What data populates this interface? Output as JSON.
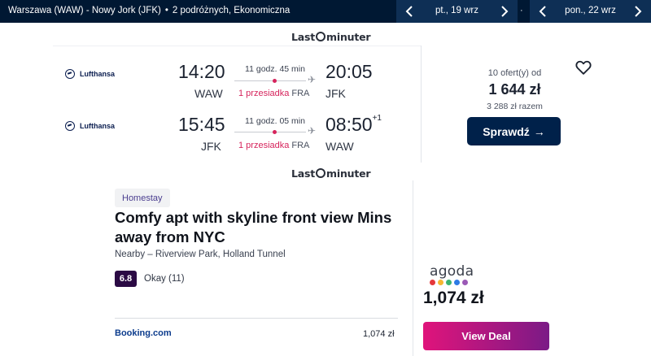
{
  "topbar": {
    "route": "Warszawa (WAW) - Nowy Jork (JFK)",
    "separator": "•",
    "passengers": "2 podróżnych, Ekonomiczna",
    "depart_date": "pt., 19 wrz",
    "return_date": "pon., 22 wrz",
    "mid_separator": "·"
  },
  "provider_logo_1": {
    "before": "Last",
    "after": "minuter"
  },
  "provider_logo_2": {
    "before": "Last",
    "after": "minuter"
  },
  "flight": {
    "outbound": {
      "airline": "Lufthansa",
      "depart_time": "14:20",
      "depart_airport": "WAW",
      "duration": "11 godz. 45 min",
      "stops": "1 przesiadka",
      "via": "FRA",
      "arrive_time": "20:05",
      "arrive_airport": "JFK",
      "day_offset": ""
    },
    "return": {
      "airline": "Lufthansa",
      "depart_time": "15:45",
      "depart_airport": "JFK",
      "duration": "11 godz. 05 min",
      "stops": "1 przesiadka",
      "via": "FRA",
      "arrive_time": "08:50",
      "arrive_airport": "WAW",
      "day_offset": "+1"
    },
    "offers_text": "10 ofert(y) od",
    "price": "1 644 zł",
    "total": "3 288 zł razem",
    "cta": "Sprawdź",
    "cta_arrow": "→"
  },
  "hotel": {
    "badge": "Homestay",
    "title": "Comfy apt with skyline front view Mins away from NYC",
    "nearby": "Nearby – Riverview Park, Holland Tunnel",
    "score": "6.8",
    "score_label": "Okay (11)",
    "booking_name": "Booking.com",
    "booking_price": "1,074 zł",
    "partner_name": "agoda",
    "partner_price": "1,074 zł",
    "cta": "View Deal"
  },
  "colors": {
    "topbar": "#001833",
    "accent_pink": "#d6245c",
    "button_navy": "#00214a",
    "agoda_dots": [
      "#e5383b",
      "#f7b731",
      "#3cb371",
      "#2d7be5",
      "#9b59b6"
    ]
  }
}
